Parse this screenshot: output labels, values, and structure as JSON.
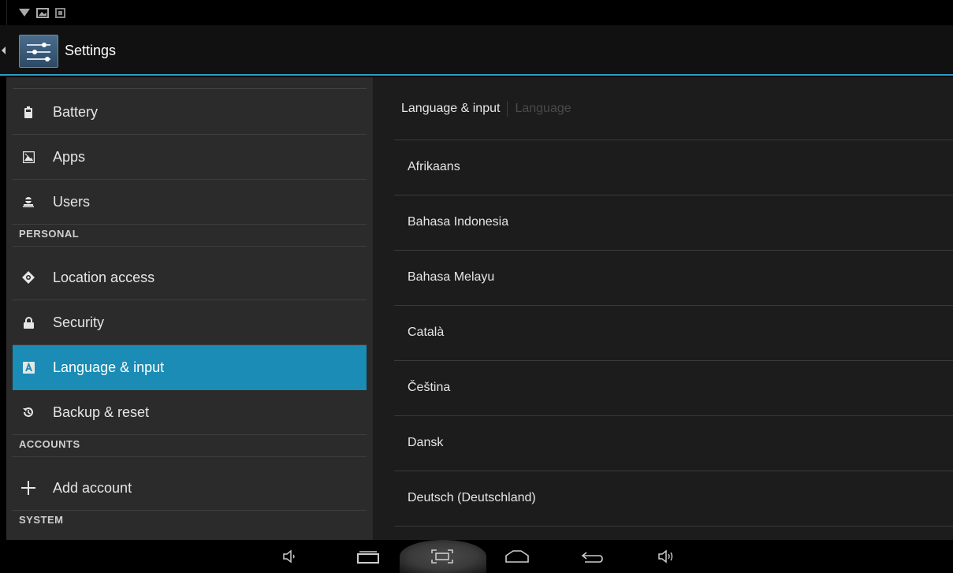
{
  "app": {
    "title": "Settings"
  },
  "sidebar": {
    "items": [
      {
        "type": "item",
        "label": "Battery",
        "icon": "battery-icon"
      },
      {
        "type": "item",
        "label": "Apps",
        "icon": "apps-icon"
      },
      {
        "type": "item",
        "label": "Users",
        "icon": "users-icon"
      },
      {
        "type": "header",
        "label": "PERSONAL"
      },
      {
        "type": "item",
        "label": "Location access",
        "icon": "location-icon"
      },
      {
        "type": "item",
        "label": "Security",
        "icon": "lock-icon"
      },
      {
        "type": "item",
        "label": "Language & input",
        "icon": "language-icon",
        "selected": true
      },
      {
        "type": "item",
        "label": "Backup & reset",
        "icon": "backup-icon"
      },
      {
        "type": "header",
        "label": "ACCOUNTS"
      },
      {
        "type": "item",
        "label": "Add account",
        "icon": "plus-icon"
      },
      {
        "type": "header",
        "label": "SYSTEM"
      }
    ]
  },
  "content": {
    "breadcrumb": {
      "current": "Language & input",
      "next": "Language"
    },
    "languages": [
      "Afrikaans",
      "Bahasa Indonesia",
      "Bahasa Melayu",
      "Català",
      "Čeština",
      "Dansk",
      "Deutsch (Deutschland)"
    ]
  },
  "navbar": {
    "buttons": [
      "volume-down-icon",
      "back-icon",
      "home-icon",
      "screenshot-icon",
      "recent-apps-icon",
      "volume-up-icon"
    ]
  },
  "colors": {
    "accent": "#2e9bc6",
    "selected": "#1a8cb5",
    "sidebar_bg": "#2b2b2b",
    "content_bg": "#1c1c1c"
  }
}
